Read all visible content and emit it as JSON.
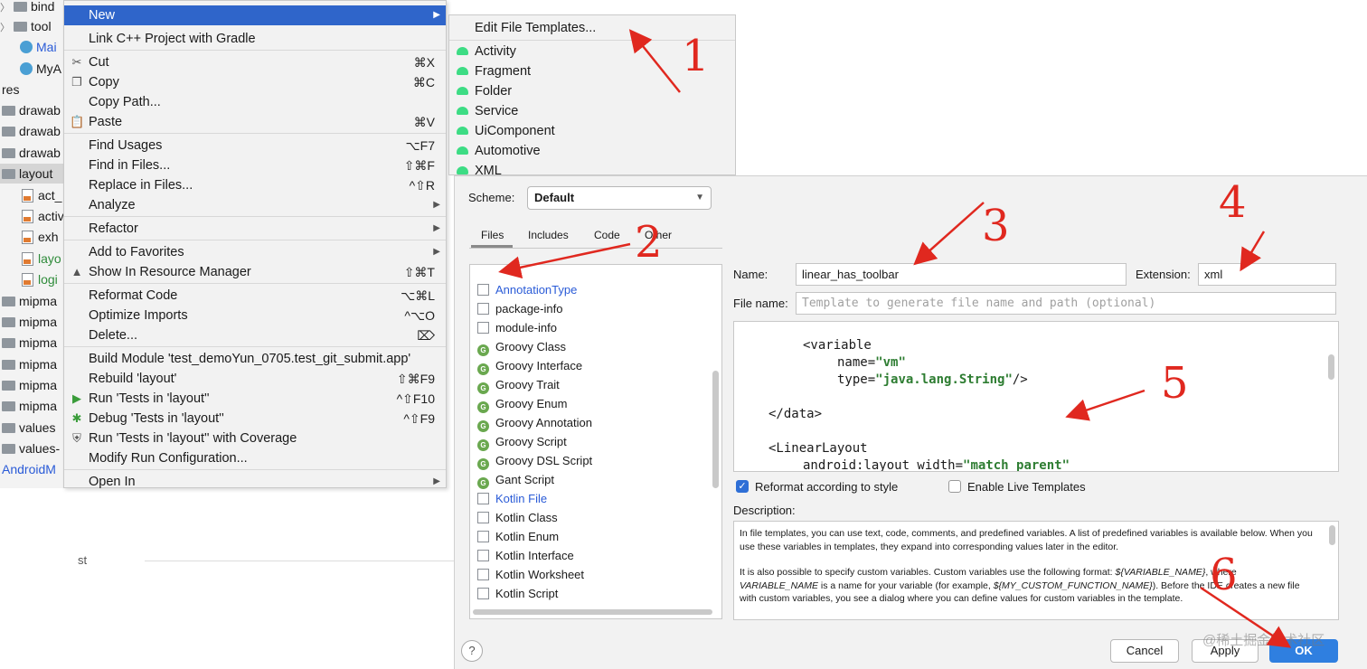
{
  "tree": {
    "items": [
      "bind",
      "tool",
      "Mai",
      "MyA",
      "res",
      "drawab",
      "drawab",
      "drawab",
      "layout",
      "act_",
      "activ",
      "exh",
      "layo",
      "logi",
      "mipma",
      "mipma",
      "mipma",
      "mipma",
      "mipma",
      "mipma",
      "values",
      "values-",
      "AndroidM"
    ],
    "bottom_text": "st"
  },
  "context_menu": {
    "items": [
      {
        "label": "New",
        "shortcut": ""
      },
      {
        "label": "Link C++ Project with Gradle",
        "shortcut": ""
      },
      {
        "label": "Cut",
        "shortcut": "⌘X"
      },
      {
        "label": "Copy",
        "shortcut": "⌘C"
      },
      {
        "label": "Copy Path...",
        "shortcut": ""
      },
      {
        "label": "Paste",
        "shortcut": "⌘V"
      },
      {
        "label": "Find Usages",
        "shortcut": "⌥F7"
      },
      {
        "label": "Find in Files...",
        "shortcut": "⇧⌘F"
      },
      {
        "label": "Replace in Files...",
        "shortcut": "^⇧R"
      },
      {
        "label": "Analyze",
        "shortcut": ""
      },
      {
        "label": "Refactor",
        "shortcut": ""
      },
      {
        "label": "Add to Favorites",
        "shortcut": ""
      },
      {
        "label": "Show In Resource Manager",
        "shortcut": "⇧⌘T"
      },
      {
        "label": "Reformat Code",
        "shortcut": "⌥⌘L"
      },
      {
        "label": "Optimize Imports",
        "shortcut": "^⌥O"
      },
      {
        "label": "Delete...",
        "shortcut": "⌦"
      },
      {
        "label": "Build Module 'test_demoYun_0705.test_git_submit.app'",
        "shortcut": ""
      },
      {
        "label": "Rebuild 'layout'",
        "shortcut": "⇧⌘F9"
      },
      {
        "label": "Run 'Tests in 'layout''",
        "shortcut": "^⇧F10"
      },
      {
        "label": "Debug 'Tests in 'layout''",
        "shortcut": "^⇧F9"
      },
      {
        "label": "Run 'Tests in 'layout'' with Coverage",
        "shortcut": ""
      },
      {
        "label": "Modify Run Configuration...",
        "shortcut": ""
      },
      {
        "label": "Open In",
        "shortcut": ""
      }
    ]
  },
  "submenu": {
    "items": [
      "Edit File Templates...",
      "Activity",
      "Fragment",
      "Folder",
      "Service",
      "UiComponent",
      "Automotive",
      "XML"
    ]
  },
  "dialog": {
    "scheme_label": "Scheme:",
    "scheme_value": "Default",
    "tabs": [
      "Files",
      "Includes",
      "Code",
      "Other"
    ],
    "files": [
      "AnnotationType",
      "package-info",
      "module-info",
      "Groovy Class",
      "Groovy Interface",
      "Groovy Trait",
      "Groovy Enum",
      "Groovy Annotation",
      "Groovy Script",
      "Groovy DSL Script",
      "Gant Script",
      "Kotlin File",
      "Kotlin Class",
      "Kotlin Enum",
      "Kotlin Interface",
      "Kotlin Worksheet",
      "Kotlin Script"
    ],
    "name_label": "Name:",
    "name_value": "linear_has_toolbar",
    "extension_label": "Extension:",
    "extension_value": "xml",
    "filename_label": "File name:",
    "filename_placeholder": "Template to generate file name and path (optional)",
    "code": {
      "l1": "<variable",
      "l2a": "name=",
      "l2b": "\"vm\"",
      "l3a": "type=",
      "l3b": "\"java.lang.String\"",
      "l3c": "/>",
      "l4": "</data>",
      "l5": "<LinearLayout",
      "l6a": "android:layout_width=",
      "l6b": "\"match_parent\""
    },
    "reformat_label": "Reformat according to style",
    "reformat_checked": true,
    "live_templates_label": "Enable Live Templates",
    "live_templates_checked": false,
    "description_label": "Description:",
    "description_p1": "In file templates, you can use text, code, comments, and predefined variables. A list of predefined variables is available below. When you use these variables in templates, they expand into corresponding values later in the editor.",
    "description_p2a": "It is also possible to specify custom variables. Custom variables use the following format: ",
    "description_p2b": "${VARIABLE_NAME}",
    "description_p2c": ", where ",
    "description_p2d": "VARIABLE_NAME",
    "description_p2e": " is a name for your variable (for example, ",
    "description_p2f": "${MY_CUSTOM_FUNCTION_NAME}",
    "description_p2g": "). Before the IDE creates a new file with custom variables, you see a dialog where you can define values for custom variables in the template.",
    "help_label": "?",
    "cancel_label": "Cancel",
    "apply_label": "Apply",
    "ok_label": "OK"
  },
  "annotations": [
    "1",
    "2",
    "3",
    "4",
    "5",
    "6"
  ],
  "watermark": "@稀土掘金技术社区",
  "colors": {
    "accent": "#2f65ca",
    "annotation": "#e0281f",
    "string": "#2e7d32"
  }
}
